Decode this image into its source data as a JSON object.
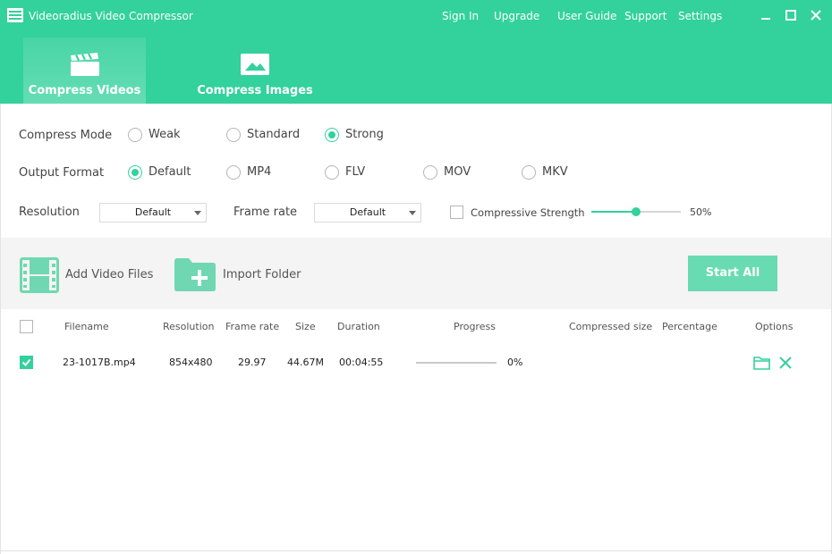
{
  "app": {
    "title": "Videoradius Video Compressor",
    "logo_icon": "app-logo-icon"
  },
  "topnav": [
    "Sign In",
    "Upgrade",
    "User Guide",
    "Support",
    "Settings"
  ],
  "window_controls": [
    "minimize-icon",
    "maximize-icon",
    "close-icon"
  ],
  "tabs": [
    {
      "label": "Compress Videos",
      "icon": "clapperboard-icon",
      "active": true
    },
    {
      "label": "Compress Images",
      "icon": "image-icon",
      "active": false
    }
  ],
  "settings": {
    "compress_mode": {
      "label": "Compress Mode",
      "options": [
        "Weak",
        "Standard",
        "Strong"
      ],
      "selected": "Strong"
    },
    "output_format": {
      "label": "Output Format",
      "options": [
        "Default",
        "MP4",
        "FLV",
        "MOV",
        "MKV"
      ],
      "selected": "Default"
    },
    "resolution": {
      "label": "Resolution",
      "value": "Default"
    },
    "frame_rate": {
      "label": "Frame rate",
      "value": "Default"
    },
    "strength": {
      "label": "Compressive Strength",
      "checked": false,
      "value": "50%",
      "fraction": 0.5
    }
  },
  "toolbar": {
    "add_files": "Add Video Files",
    "import_folder": "Import Folder",
    "start_all": "Start All"
  },
  "table": {
    "headers": [
      "Filename",
      "Resolution",
      "Frame rate",
      "Size",
      "Duration",
      "Progress",
      "Compressed size",
      "Percentage",
      "Options"
    ],
    "rows": [
      {
        "checked": true,
        "filename": "23-1017B.mp4",
        "resolution": "854x480",
        "frame_rate": "29.97",
        "size": "44.67M",
        "duration": "00:04:55",
        "progress": "0%",
        "progress_fraction": 0,
        "compressed_size": "",
        "percentage": ""
      }
    ]
  },
  "colors": {
    "accent": "#33d19b",
    "accent_light": "#69dbb2",
    "toolbar_bg": "#f4f4f4"
  }
}
